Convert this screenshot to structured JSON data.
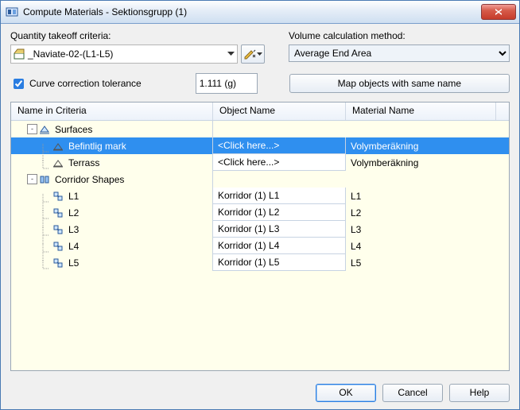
{
  "window": {
    "title": "Compute Materials - Sektionsgrupp (1)"
  },
  "form": {
    "quantity_takeoff_label": "Quantity takeoff criteria:",
    "quantity_takeoff_value": "_Naviate-02-(L1-L5)",
    "volume_method_label": "Volume calculation method:",
    "volume_method_value": "Average End Area",
    "curve_correction_label": "Curve correction tolerance",
    "curve_correction_value": "1.111 (g)",
    "map_button_label": "Map objects with same name"
  },
  "grid": {
    "columns": [
      "Name in Criteria",
      "Object Name",
      "Material Name"
    ],
    "rows": [
      {
        "type": "group",
        "level": 0,
        "expanded": true,
        "icon": "surface-group-icon",
        "name": "Surfaces"
      },
      {
        "type": "item",
        "level": 1,
        "selected": true,
        "icon": "surface-icon",
        "name": "Befintlig mark",
        "object": "<Click here...>",
        "material": "Volymberäkning"
      },
      {
        "type": "item",
        "level": 1,
        "icon": "surface-icon",
        "name": "Terrass",
        "object": "<Click here...>",
        "material": "Volymberäkning"
      },
      {
        "type": "group",
        "level": 0,
        "expanded": true,
        "icon": "corridor-group-icon",
        "name": "Corridor Shapes"
      },
      {
        "type": "item",
        "level": 1,
        "icon": "shape-icon",
        "name": "L1",
        "object": "Korridor (1) L1",
        "material": "L1"
      },
      {
        "type": "item",
        "level": 1,
        "icon": "shape-icon",
        "name": "L2",
        "object": "Korridor (1) L2",
        "material": "L2"
      },
      {
        "type": "item",
        "level": 1,
        "icon": "shape-icon",
        "name": "L3",
        "object": "Korridor (1) L3",
        "material": "L3"
      },
      {
        "type": "item",
        "level": 1,
        "icon": "shape-icon",
        "name": "L4",
        "object": "Korridor (1) L4",
        "material": "L4"
      },
      {
        "type": "item",
        "level": 1,
        "icon": "shape-icon",
        "name": "L5",
        "object": "Korridor (1) L5",
        "material": "L5"
      }
    ]
  },
  "buttons": {
    "ok": "OK",
    "cancel": "Cancel",
    "help": "Help"
  },
  "icons": {
    "surface-group-icon": "<svg width='14' height='14'><polygon points='2,10 7,3 12,10' fill='#d0e8ff' stroke='#2a5a9a'/><line x1='1' y1='12' x2='13' y2='12' stroke='#2a5a9a'/></svg>",
    "surface-icon": "<svg width='14' height='14'><polygon points='2,11 7,4 12,11' fill='none' stroke='#555'/><line x1='1' y1='12' x2='13' y2='12' stroke='#555'/></svg>",
    "corridor-group-icon": "<svg width='14' height='14'><rect x='2' y='3' width='4' height='8' fill='#9cc7f5' stroke='#2a5a9a'/><rect x='8' y='3' width='4' height='8' fill='#9cc7f5' stroke='#2a5a9a'/></svg>",
    "shape-icon": "<svg width='14' height='14'><rect x='2' y='2' width='5' height='5' fill='#cfe6ff' stroke='#2a5a9a'/><rect x='7' y='7' width='5' height='5' fill='#cfe6ff' stroke='#2a5a9a'/><line x1='6' y1='6' x2='8' y2='8' stroke='#2a5a9a'/></svg>"
  }
}
